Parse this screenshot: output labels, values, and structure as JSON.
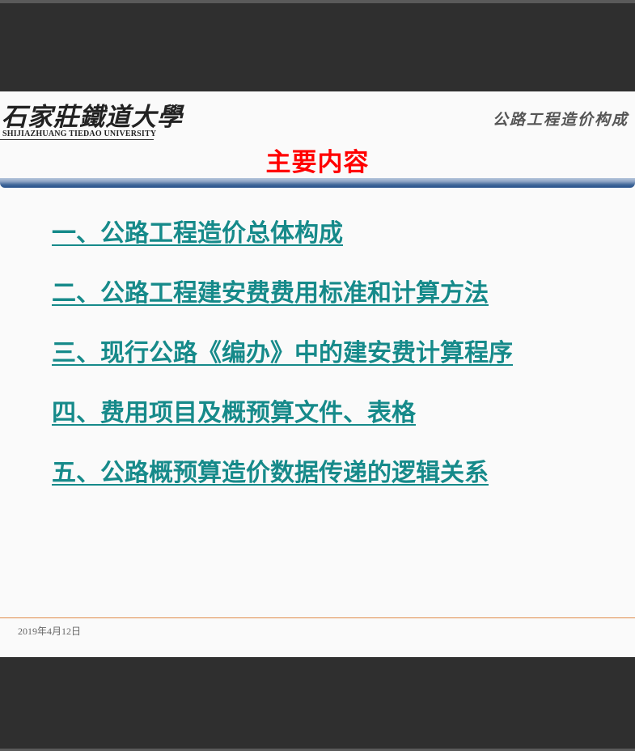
{
  "header": {
    "logo_cn": "石家莊鐵道大學",
    "logo_en": "SHIJIAZHUANG TIEDAO UNIVERSITY",
    "course_title": "公路工程造价构成"
  },
  "slide": {
    "heading": "主要内容",
    "items": [
      "一、公路工程造价总体构成",
      "二、公路工程建安费费用标准和计算方法",
      "三、现行公路《编办》中的建安费计算程序",
      "四、费用项目及概预算文件、表格",
      "五、公路概预算造价数据传递的逻辑关系"
    ],
    "date": "2019年4月12日"
  },
  "colors": {
    "heading": "#ff0000",
    "link": "#168a8a",
    "footer_line": "#e08a4a",
    "background": "#2f2f2f"
  }
}
